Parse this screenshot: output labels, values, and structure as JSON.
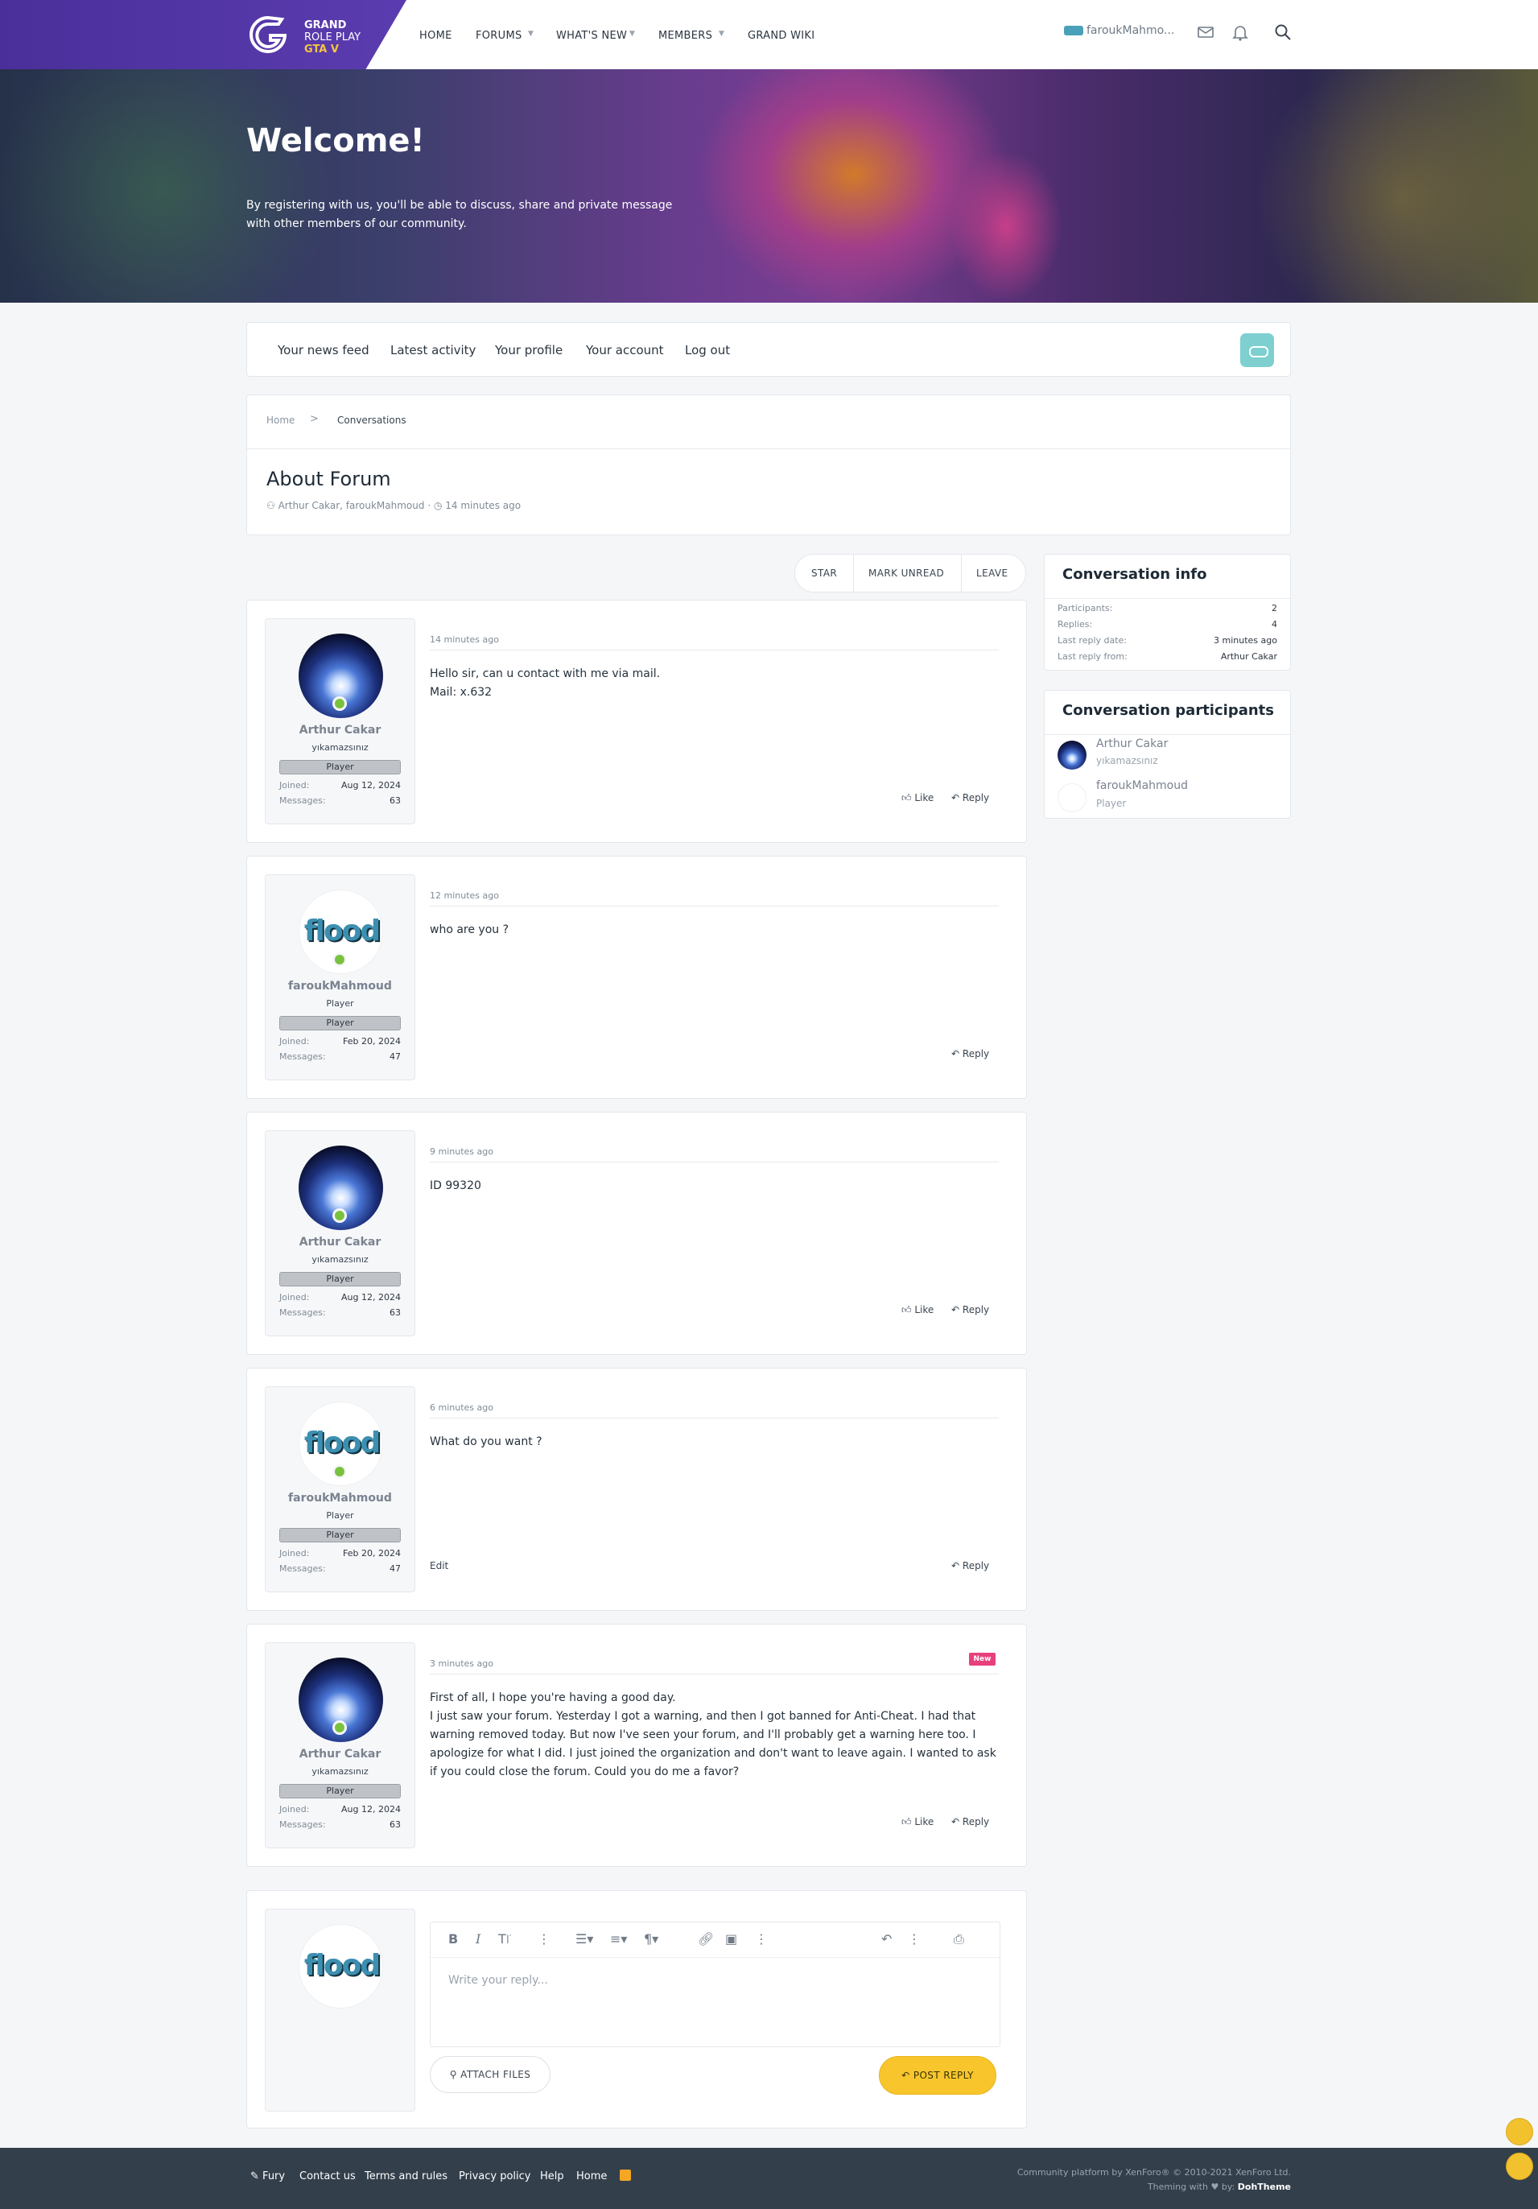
{
  "brand": {
    "line1": "GRAND",
    "line2": "ROLE PLAY",
    "line3": "GTA V"
  },
  "nav": {
    "items": [
      {
        "label": "HOME",
        "dropdown": false
      },
      {
        "label": "FORUMS",
        "dropdown": true
      },
      {
        "label": "WHAT'S NEW",
        "dropdown": true
      },
      {
        "label": "MEMBERS",
        "dropdown": true
      },
      {
        "label": "GRAND WIKI",
        "dropdown": false
      }
    ],
    "username": "faroukMahmo...",
    "icons": [
      "mail-icon",
      "bell-icon",
      "search-icon"
    ]
  },
  "hero": {
    "title": "Welcome!",
    "subtitle": "By registering with us, you'll be able to discuss, share and private message with other members of our community."
  },
  "account_links": [
    "Your news feed",
    "Latest activity",
    "Your profile",
    "Your account",
    "Log out"
  ],
  "breadcrumb": {
    "home": "Home",
    "current": "Conversations",
    "separator": ">"
  },
  "conversation": {
    "title": "About Forum",
    "participants_line": "Arthur Cakar, faroukMahmoud",
    "time": "14 minutes ago"
  },
  "actions": {
    "star": "STAR",
    "mark_unread": "MARK UNREAD",
    "leave": "LEAVE"
  },
  "messages": [
    {
      "time": "14 minutes ago",
      "lines": [
        "Hello sir, can u contact with me via mail.",
        "Mail: x.632"
      ],
      "user": {
        "name": "Arthur Cakar",
        "title": "yıkamazsınız",
        "banner": "Player",
        "joined": "Aug 12, 2024",
        "messages": "63"
      },
      "like": "Like",
      "reply": "Reply"
    },
    {
      "time": "12 minutes ago",
      "lines": [
        "who are you ?"
      ],
      "user": {
        "name": "faroukMahmoud",
        "title": "Player",
        "banner": "Player",
        "joined": "Feb 20, 2024",
        "messages": "47"
      },
      "reply": "Reply"
    },
    {
      "time": "9 minutes ago",
      "lines": [
        "ID 99320"
      ],
      "user": {
        "name": "Arthur Cakar",
        "title": "yıkamazsınız",
        "banner": "Player",
        "joined": "Aug 12, 2024",
        "messages": "63"
      },
      "like": "Like",
      "reply": "Reply"
    },
    {
      "time": "6 minutes ago",
      "lines": [
        "What do you want ?"
      ],
      "user": {
        "name": "faroukMahmoud",
        "title": "Player",
        "banner": "Player",
        "joined": "Feb 20, 2024",
        "messages": "47"
      },
      "edit": "Edit",
      "reply": "Reply"
    },
    {
      "time": "3 minutes ago",
      "badge": "New",
      "lines": [
        "First of all, I hope you're having a good day.",
        "I just saw your forum. Yesterday I got a warning, and then I got banned for Anti-Cheat. I had that warning removed today. But now I've seen your forum, and I'll probably get a warning here too. I apologize for what I did. I just joined the organization and don't want to leave again. I wanted to ask if you could close the forum. Could you do me a favor?"
      ],
      "user": {
        "name": "Arthur Cakar",
        "title": "yıkamazsınız",
        "banner": "Player",
        "joined": "Aug 12, 2024",
        "messages": "63"
      },
      "like": "Like",
      "reply": "Reply"
    }
  ],
  "stat_labels": {
    "joined": "Joined:",
    "messages": "Messages:"
  },
  "reply_box": {
    "placeholder": "Write your reply...",
    "attach": "ATTACH FILES",
    "post": "POST REPLY",
    "avatar_word": "flood"
  },
  "avatar_word": "flood",
  "sidebar": {
    "info": {
      "title": "Conversation info",
      "rows": [
        {
          "label": "Participants:",
          "value": "2"
        },
        {
          "label": "Replies:",
          "value": "4"
        },
        {
          "label": "Last reply date:",
          "value": "3 minutes ago"
        },
        {
          "label": "Last reply from:",
          "value": "Arthur Cakar"
        }
      ]
    },
    "participants": {
      "title": "Conversation participants",
      "list": [
        {
          "name": "Arthur Cakar",
          "title": "yıkamazsınız"
        },
        {
          "name": "faroukMahmoud",
          "title": "Player"
        }
      ]
    }
  },
  "footer": {
    "links": [
      "Fury",
      "Contact us",
      "Terms and rules",
      "Privacy policy",
      "Help",
      "Home"
    ],
    "copyright": "Community platform by XenForo® © 2010-2021 XenForo Ltd.",
    "theming_prefix": "Theming with",
    "theming_by": "by:",
    "theming_name": "DohTheme"
  },
  "colors": {
    "brand_purple": "#5b3cb0",
    "accent_yellow": "#f8c62c",
    "online_green": "#7ac13f",
    "new_badge": "#e8407d",
    "footer_bg": "#333f4b"
  }
}
